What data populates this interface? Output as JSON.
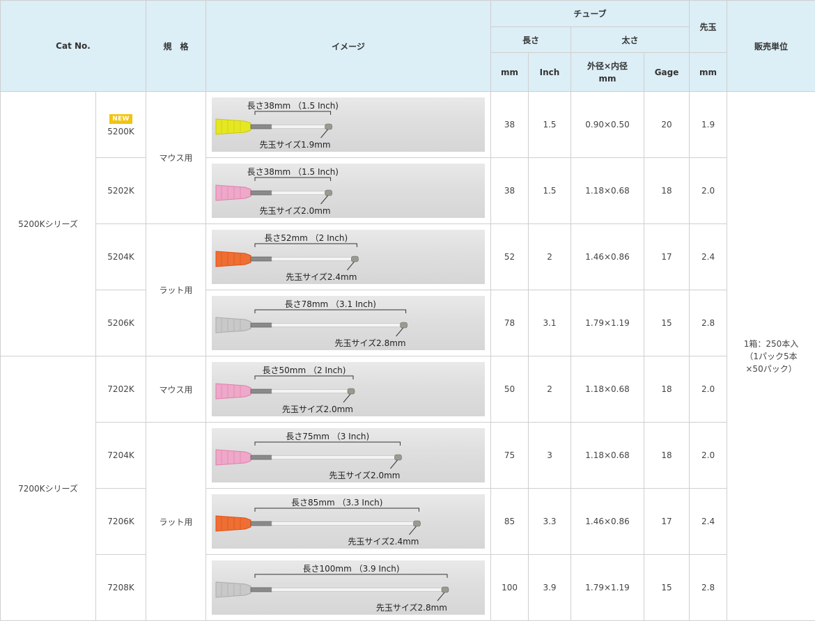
{
  "header": {
    "cat_no": "Cat No.",
    "spec": "規　格",
    "image": "イメージ",
    "tube": "チューブ",
    "length": "長さ",
    "thickness": "太さ",
    "tip": "先玉",
    "sales_unit": "販売単位",
    "mm": "mm",
    "inch": "Inch",
    "od_id_line1": "外径×内径",
    "od_id_line2": "mm",
    "gage": "Gage",
    "tip_mm": "mm"
  },
  "series": [
    {
      "name": "5200Kシリーズ"
    },
    {
      "name": "7200Kシリーズ"
    }
  ],
  "specs": {
    "mouse": "マウス用",
    "rat": "ラット用"
  },
  "new_badge": "NEW",
  "sales_unit": {
    "line1": "1箱：250本入",
    "line2": "（1パック5本",
    "line3": "×50パック）"
  },
  "rows": [
    {
      "cat": "5200K",
      "length_label": "長さ38mm （1.5 Inch)",
      "tip_label": "先玉サイズ1.9mm",
      "mm": "38",
      "inch": "1.5",
      "od_id": "0.90×0.50",
      "gage": "20",
      "tip": "1.9",
      "hub_color": "#e6e81a",
      "hub_color_dark": "#c8c800",
      "tube_len_mm": 38
    },
    {
      "cat": "5202K",
      "length_label": "長さ38mm （1.5 Inch)",
      "tip_label": "先玉サイズ2.0mm",
      "mm": "38",
      "inch": "1.5",
      "od_id": "1.18×0.68",
      "gage": "18",
      "tip": "2.0",
      "hub_color": "#f0a6c8",
      "hub_color_dark": "#e07aa8",
      "tube_len_mm": 38
    },
    {
      "cat": "5204K",
      "length_label": "長さ52mm （2 Inch)",
      "tip_label": "先玉サイズ2.4mm",
      "mm": "52",
      "inch": "2",
      "od_id": "1.46×0.86",
      "gage": "17",
      "tip": "2.4",
      "hub_color": "#f06a2a",
      "hub_color_dark": "#e04810",
      "tube_len_mm": 52
    },
    {
      "cat": "5206K",
      "length_label": "長さ78mm （3.1 Inch)",
      "tip_label": "先玉サイズ2.8mm",
      "mm": "78",
      "inch": "3.1",
      "od_id": "1.79×1.19",
      "gage": "15",
      "tip": "2.8",
      "hub_color": "#c8c8c8",
      "hub_color_dark": "#a8a8a8",
      "tube_len_mm": 78
    },
    {
      "cat": "7202K",
      "length_label": "長さ50mm （2 Inch)",
      "tip_label": "先玉サイズ2.0mm",
      "mm": "50",
      "inch": "2",
      "od_id": "1.18×0.68",
      "gage": "18",
      "tip": "2.0",
      "hub_color": "#f0a6c8",
      "hub_color_dark": "#e07aa8",
      "tube_len_mm": 50
    },
    {
      "cat": "7204K",
      "length_label": "長さ75mm （3 Inch)",
      "tip_label": "先玉サイズ2.0mm",
      "mm": "75",
      "inch": "3",
      "od_id": "1.18×0.68",
      "gage": "18",
      "tip": "2.0",
      "hub_color": "#f0a6c8",
      "hub_color_dark": "#e07aa8",
      "tube_len_mm": 75
    },
    {
      "cat": "7206K",
      "length_label": "長さ85mm （3.3 Inch)",
      "tip_label": "先玉サイズ2.4mm",
      "mm": "85",
      "inch": "3.3",
      "od_id": "1.46×0.86",
      "gage": "17",
      "tip": "2.4",
      "hub_color": "#f06a2a",
      "hub_color_dark": "#e04810",
      "tube_len_mm": 85
    },
    {
      "cat": "7208K",
      "length_label": "長さ100mm （3.9 Inch)",
      "tip_label": "先玉サイズ2.8mm",
      "mm": "100",
      "inch": "3.9",
      "od_id": "1.79×1.19",
      "gage": "15",
      "tip": "2.8",
      "hub_color": "#c8c8c8",
      "hub_color_dark": "#a8a8a8",
      "tube_len_mm": 100
    }
  ]
}
